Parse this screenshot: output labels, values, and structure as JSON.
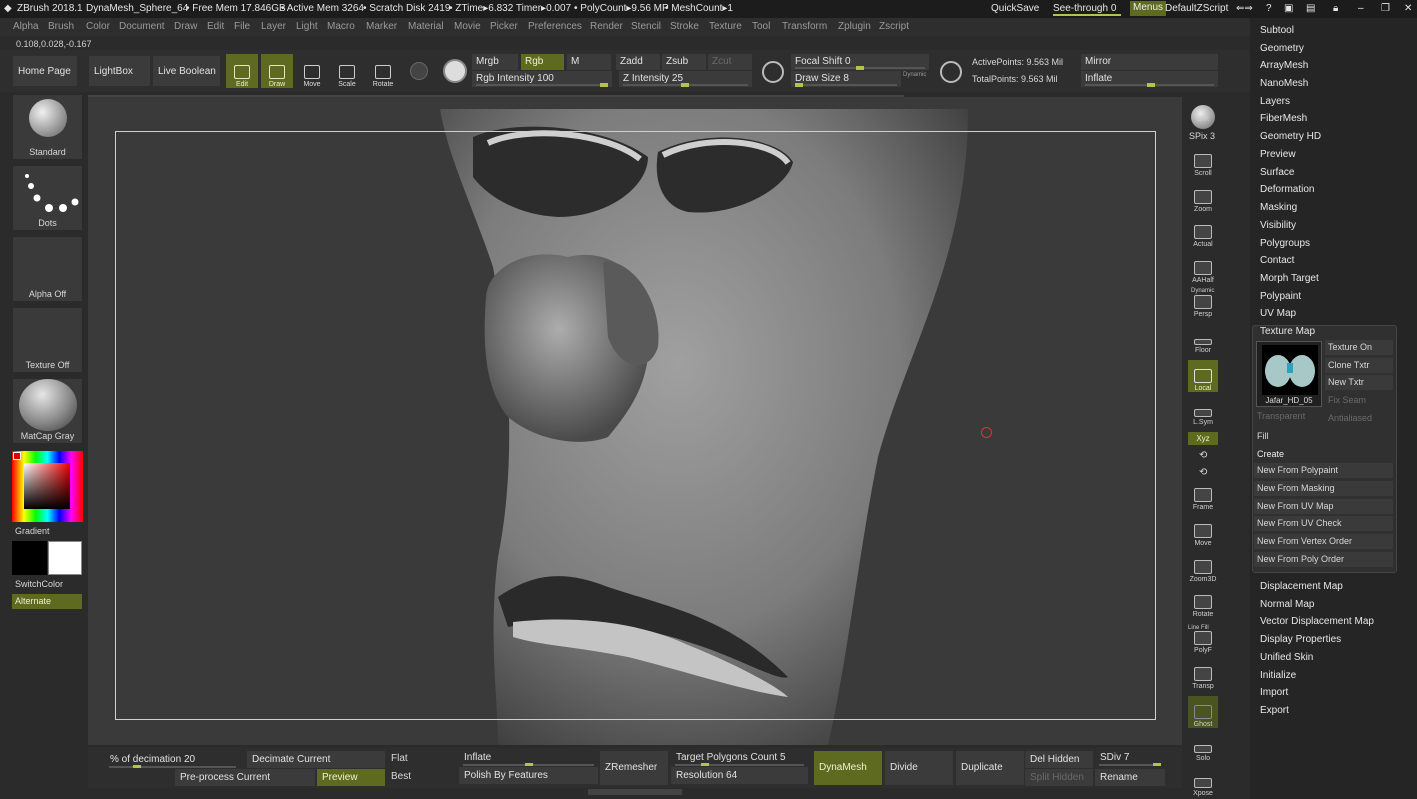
{
  "titlebar": {
    "app": "ZBrush 2018.1",
    "document": "DynaMesh_Sphere_64",
    "free_mem": "• Free Mem 17.846GB",
    "active_mem": "• Active Mem 3264",
    "scratch": "• Scratch Disk 2419",
    "ztime": "• ZTime▸6.832 Timer▸0.007",
    "polycount": "• PolyCount▸9.56 MP",
    "meshcount": "• MeshCount▸1",
    "quicksave": "QuickSave",
    "see_through": "See-through  0",
    "menus": "Menus",
    "default_zscript": "DefaultZScript"
  },
  "menubar": [
    "Alpha",
    "Brush",
    "Color",
    "Document",
    "Draw",
    "Edit",
    "File",
    "Layer",
    "Light",
    "Macro",
    "Marker",
    "Material",
    "Movie",
    "Picker",
    "Preferences",
    "Render",
    "Stencil",
    "Stroke",
    "Texture",
    "Tool",
    "Transform",
    "Zplugin",
    "Zscript"
  ],
  "coords": "0.108,0.028,-0.167",
  "toolbar": {
    "home_page": "Home Page",
    "lightbox": "LightBox",
    "live_boolean": "Live Boolean",
    "edit": "Edit",
    "draw": "Draw",
    "move": "Move",
    "scale": "Scale",
    "rotate": "Rotate",
    "mrgb": "Mrgb",
    "rgb": "Rgb",
    "m": "M",
    "rgb_intensity_label": "Rgb Intensity",
    "rgb_intensity_value": "100",
    "zadd": "Zadd",
    "zsub": "Zsub",
    "zcut": "Zcut",
    "z_intensity_label": "Z Intensity",
    "z_intensity_value": "25",
    "focal_shift_label": "Focal Shift",
    "focal_shift_value": "0",
    "draw_size_label": "Draw Size",
    "draw_size_value": "8",
    "dynamic": "Dynamic",
    "active_points": "ActivePoints: 9.563 Mil",
    "total_points": "TotalPoints: 9.563 Mil",
    "mirror": "Mirror",
    "inflate": "Inflate"
  },
  "left_shelf": {
    "brush": "Standard",
    "stroke": "Dots",
    "alpha": "Alpha Off",
    "texture": "Texture Off",
    "material": "MatCap Gray",
    "gradient": "Gradient",
    "switch_color": "SwitchColor",
    "alternate": "Alternate"
  },
  "right_shelf": [
    "BPR",
    "SPix 3",
    "Scroll",
    "Zoom",
    "Actual",
    "AAHalf",
    "Persp",
    "Floor",
    "Local",
    "L.Sym",
    "Xyz",
    "Frame",
    "Move",
    "Zoom3D",
    "Rotate",
    "PolyF",
    "Transp",
    "Ghost",
    "Solo",
    "Xpose"
  ],
  "right_shelf_extra": {
    "dynamic": "Dynamic",
    "line_fill": "Line Fill"
  },
  "right_panel": {
    "top_items": [
      "Subtool",
      "Geometry",
      "ArrayMesh",
      "NanoMesh",
      "Layers",
      "FiberMesh",
      "Geometry HD",
      "Preview",
      "Surface",
      "Deformation",
      "Masking",
      "Visibility",
      "Polygroups",
      "Contact",
      "Morph Target",
      "Polypaint",
      "UV Map"
    ],
    "texture_map": {
      "title": "Texture Map",
      "thumb_label": "Jafar_HD_05",
      "texture_on": "Texture On",
      "clone_txtr": "Clone Txtr",
      "new_txtr": "New Txtr",
      "fix_seam": "Fix Seam",
      "transparent": "Transparent",
      "antialiased": "Antialiased",
      "fill": "Fill",
      "create": "Create",
      "create_items": [
        "New From Polypaint",
        "New From Masking",
        "New From UV Map",
        "New From UV Check",
        "New From Vertex Order",
        "New From Poly Order"
      ]
    },
    "bottom_items": [
      "Displacement Map",
      "Normal Map",
      "Vector Displacement Map",
      "Display Properties",
      "Unified Skin",
      "Initialize",
      "Import",
      "Export"
    ]
  },
  "bottombar": {
    "decimation_label": "% of decimation",
    "decimation_value": "20",
    "decimate_current": "Decimate Current",
    "flat": "Flat",
    "preprocess_current": "Pre-process Current",
    "preview": "Preview",
    "best": "Best",
    "inflate": "Inflate",
    "polish_by_features": "Polish By Features",
    "zremesher": "ZRemesher",
    "target_poly_label": "Target Polygons Count",
    "target_poly_value": "5",
    "resolution_label": "Resolution",
    "resolution_value": "64",
    "dynamesh": "DynaMesh",
    "divide": "Divide",
    "duplicate": "Duplicate",
    "del_hidden": "Del Hidden",
    "split_hidden": "Split Hidden",
    "sdiv_label": "SDiv",
    "sdiv_value": "7",
    "rename": "Rename"
  },
  "colors": {
    "accent_olive": "#5e6a1f",
    "slider_knob": "#b7c24a",
    "panel_bg": "#2e2e2e",
    "canvas_bg": "#3a3a3a"
  }
}
